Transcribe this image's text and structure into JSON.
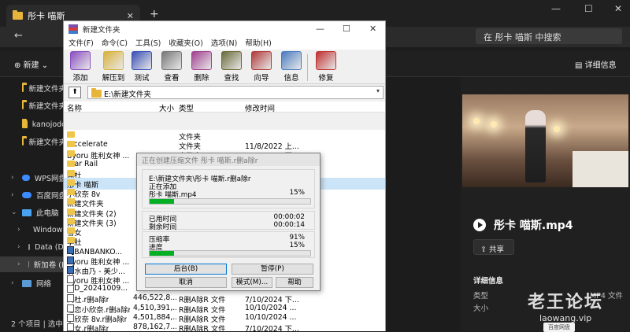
{
  "explorer": {
    "tab_title": "彤卡 喵斯",
    "tab_close": "✕",
    "tab_new": "+",
    "win_min": "—",
    "win_max": "☐",
    "win_close": "✕",
    "nav_back": "←",
    "search_placeholder": "在 彤卡 喵斯 中搜索",
    "new_label": "新建",
    "detail_label": "详细信息",
    "sidebar": [
      {
        "label": "新建文件夹"
      },
      {
        "label": "新建文件夹"
      },
      {
        "label": "kanojodo"
      },
      {
        "label": "新建文件夹"
      },
      {
        "label": "WPS网盘"
      },
      {
        "label": "百度网盘"
      },
      {
        "label": "此电脑"
      },
      {
        "label": "Windows"
      },
      {
        "label": "Data (D:"
      },
      {
        "label": "新加卷 (E"
      },
      {
        "label": "网络"
      }
    ],
    "status": "2 个项目  |  选中",
    "details": {
      "file_name": "彤卡 喵斯.mp4",
      "share_label": "共享",
      "section_title": "详细信息",
      "rows": [
        {
          "k": "类型",
          "v": "MP4 文件"
        },
        {
          "k": "大小",
          "v": ""
        }
      ]
    },
    "watermark": {
      "main": "老王论坛",
      "sub": "laowang.vip",
      "badge": "百度网盘"
    }
  },
  "winrar": {
    "title": "新建文件夹",
    "menu": [
      "文件(F)",
      "命令(C)",
      "工具(S)",
      "收藏夹(O)",
      "选项(N)",
      "帮助(H)"
    ],
    "tools": [
      {
        "label": "添加",
        "icon": "add-archive-icon",
        "color": "#8a4fc0"
      },
      {
        "label": "解压到",
        "icon": "extract-to-icon",
        "color": "#d9b23a"
      },
      {
        "label": "测试",
        "icon": "test-icon",
        "color": "#3a4fb5"
      },
      {
        "label": "查看",
        "icon": "view-icon",
        "color": "#777777"
      },
      {
        "label": "删除",
        "icon": "delete-icon",
        "color": "#a04090"
      },
      {
        "label": "查找",
        "icon": "find-icon",
        "color": "#6a6a3a"
      },
      {
        "label": "向导",
        "icon": "wizard-icon",
        "color": "#b03a3a"
      },
      {
        "label": "信息",
        "icon": "info-icon",
        "color": "#4a7bc0"
      },
      {
        "label": "修复",
        "icon": "repair-icon",
        "color": "#c03030"
      }
    ],
    "path": "E:\\新建文件夹",
    "columns": {
      "name": "名称",
      "size": "大小",
      "type": "类型",
      "date": "修改时间"
    },
    "files": [
      {
        "name": "..",
        "size": "",
        "type": "文件夹",
        "date": "",
        "icon": "folder"
      },
      {
        "name": ".accelerate",
        "size": "",
        "type": "文件夹",
        "date": "11/8/2022 上...",
        "icon": "folder"
      },
      {
        "name": "Byoru 胜利女神 ...",
        "size": "",
        "type": "文件夹",
        "date": "8/10/2024 下...",
        "icon": "folder"
      },
      {
        "name": "Star Rail",
        "size": "",
        "type": "文件夹",
        "date": "3/6/2024 下午...",
        "icon": "folder"
      },
      {
        "name": "闻杜",
        "size": "",
        "type": "",
        "date": "",
        "icon": "folder"
      },
      {
        "name": "彤卡 喵斯",
        "size": "",
        "type": "",
        "date": "",
        "icon": "folder"
      },
      {
        "name": "小欣奈 8v",
        "size": "",
        "type": "",
        "date": "",
        "icon": "folder"
      },
      {
        "name": "新建文件夹",
        "size": "",
        "type": "",
        "date": "",
        "icon": "folder"
      },
      {
        "name": "新建文件夹 (2)",
        "size": "",
        "type": "",
        "date": "",
        "icon": "folder"
      },
      {
        "name": "新建文件夹 (3)",
        "size": "",
        "type": "",
        "date": "",
        "icon": "folder"
      },
      {
        "name": "雪女",
        "size": "",
        "type": "",
        "date": "",
        "icon": "folder"
      },
      {
        "name": "孕肚",
        "size": "",
        "type": "",
        "date": "",
        "icon": "folder"
      },
      {
        "name": "【BANBANKO...",
        "size": "4",
        "type": "",
        "date": "",
        "icon": "blue"
      },
      {
        "name": "Byoru 胜利女神 ...",
        "size": "1",
        "type": "",
        "date": "",
        "icon": "blue"
      },
      {
        "name": "清水由乃 - 美少...",
        "size": "4",
        "type": "",
        "date": "",
        "icon": "blue"
      },
      {
        "name": "Byoru 胜利女神 ...",
        "size": "",
        "type": "",
        "date": "",
        "icon": "doc"
      },
      {
        "name": "VID_20241009...",
        "size": "",
        "type": "",
        "date": "",
        "icon": "doc"
      },
      {
        "name": "闻杜.r删a除r",
        "size": "446,522,8...",
        "type": "R删A除R 文件",
        "date": "7/10/2024 下...",
        "icon": "doc"
      },
      {
        "name": "塘恋小欣奈.r删a除r",
        "size": "4,510,391,...",
        "type": "R删A除R 文件",
        "date": "10/10/2024 ...",
        "icon": "doc"
      },
      {
        "name": "小欣奈 8v.r删a除r",
        "size": "4,501,884,...",
        "type": "R删A除R 文件",
        "date": "10/10/2024 ...",
        "icon": "doc"
      },
      {
        "name": "雪女.r删a除r",
        "size": "878,162,7...",
        "type": "R删A除R 文件",
        "date": "7/10/2024 下...",
        "icon": "doc"
      }
    ]
  },
  "dialog": {
    "title": "正在创建压缩文件 彤卡 喵斯.r删a除r",
    "archive_path": "E:\\新建文件夹\\彤卡 喵斯.r删a除r",
    "status": "正在添加",
    "current_file": "彤卡 喵斯.mp4",
    "file_pct": "15%",
    "file_progress": 0.15,
    "elapsed_label": "已用时间",
    "elapsed": "00:00:02",
    "remaining_label": "剩余时间",
    "remaining": "00:00:14",
    "ratio_label": "压缩率",
    "ratio": "91%",
    "progress_label": "进度",
    "progress_pct": "15%",
    "total_progress": 0.15,
    "buttons": {
      "background": "后台(B)",
      "pause": "暂停(P)",
      "cancel": "取消",
      "mode": "模式(M)...",
      "help": "帮助"
    },
    "bar_color": "#06b025"
  }
}
